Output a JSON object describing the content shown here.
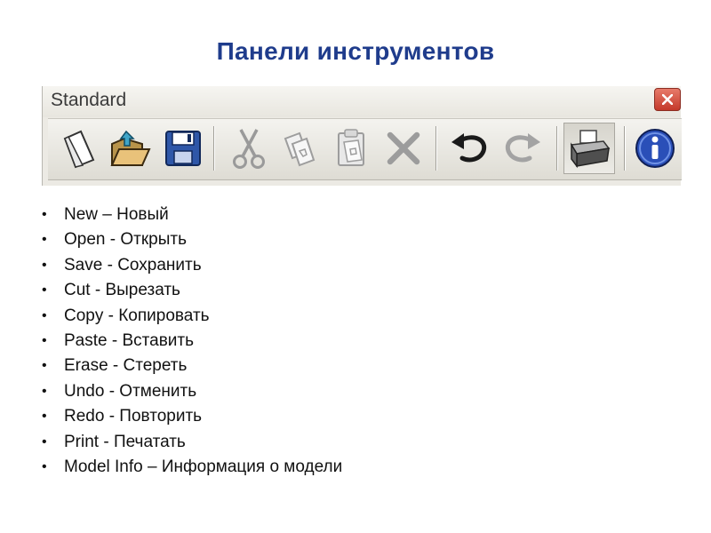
{
  "slide": {
    "title": "Панели инструментов"
  },
  "toolbar": {
    "title": "Standard",
    "close_label": "×",
    "buttons": [
      {
        "id": "new",
        "icon": "new-document-icon"
      },
      {
        "id": "open",
        "icon": "open-folder-icon"
      },
      {
        "id": "save",
        "icon": "floppy-disk-icon"
      },
      {
        "id": "cut",
        "icon": "scissors-icon"
      },
      {
        "id": "copy",
        "icon": "copy-icon"
      },
      {
        "id": "paste",
        "icon": "paste-clipboard-icon"
      },
      {
        "id": "erase",
        "icon": "erase-x-icon"
      },
      {
        "id": "undo",
        "icon": "undo-arrow-icon"
      },
      {
        "id": "redo",
        "icon": "redo-arrow-icon"
      },
      {
        "id": "print",
        "icon": "printer-icon"
      },
      {
        "id": "model_info",
        "icon": "info-icon"
      }
    ]
  },
  "bullets": [
    "New – Новый",
    "Open - Открыть",
    "Save - Сохранить",
    "Cut - Вырезать",
    "Copy - Копировать",
    "Paste - Вставить",
    "Erase - Стереть",
    "Undo - Отменить",
    "Redo - Повторить",
    "Print - Печатать",
    "Model Info – Информация о модели"
  ],
  "colors": {
    "title": "#1f3c8c",
    "toolbar_bg": "#eceae4",
    "close_button": "#c4392a",
    "info_button": "#2a4fb8"
  }
}
